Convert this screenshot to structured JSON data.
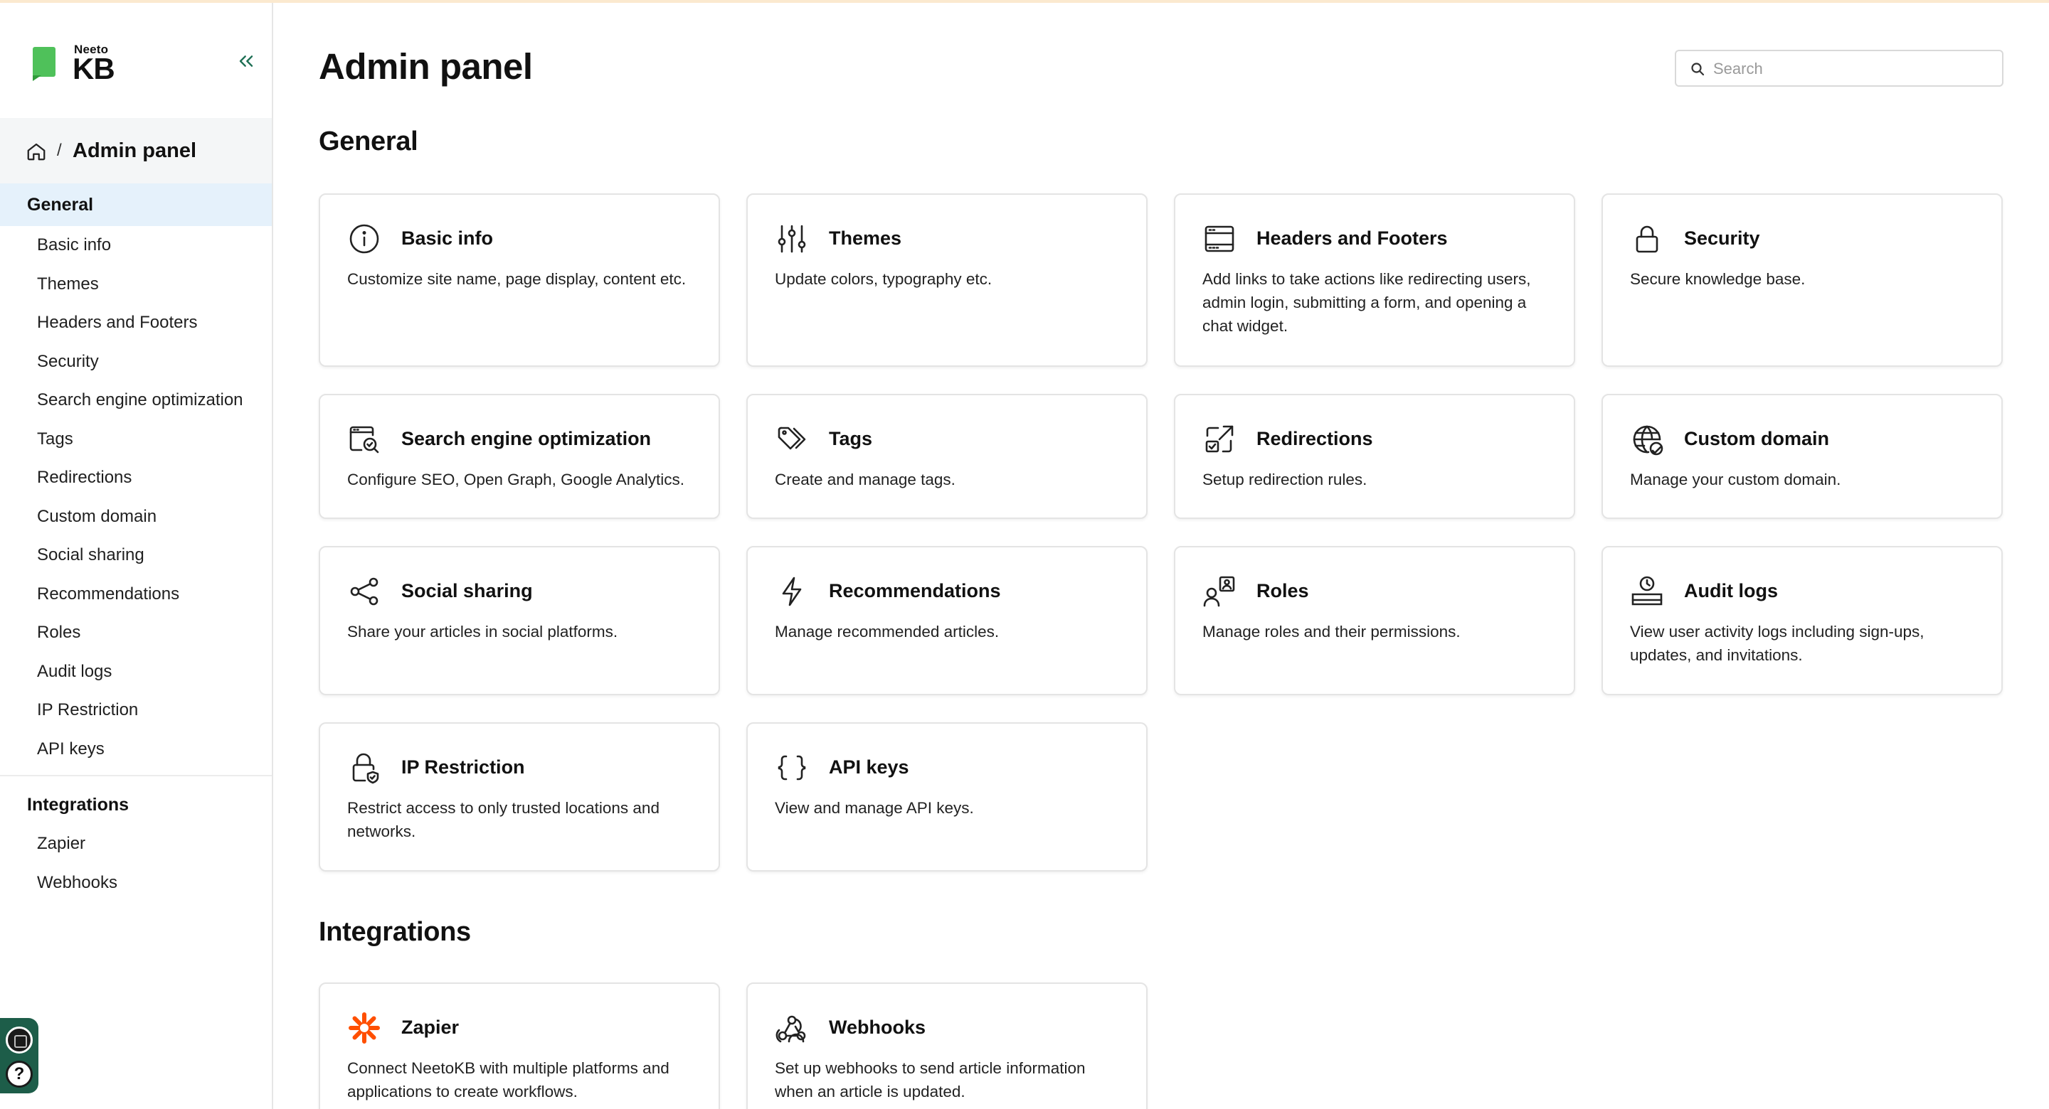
{
  "app": {
    "logo_small": "Neeto",
    "logo_big": "KB"
  },
  "breadcrumb": {
    "label": "Admin panel",
    "separator": "/"
  },
  "page": {
    "title": "Admin panel"
  },
  "search": {
    "placeholder": "Search"
  },
  "sidebar": {
    "general_label": "General",
    "general_items": [
      {
        "label": "Basic info"
      },
      {
        "label": "Themes"
      },
      {
        "label": "Headers and Footers"
      },
      {
        "label": "Security"
      },
      {
        "label": "Search engine optimization"
      },
      {
        "label": "Tags"
      },
      {
        "label": "Redirections"
      },
      {
        "label": "Custom domain"
      },
      {
        "label": "Social sharing"
      },
      {
        "label": "Recommendations"
      },
      {
        "label": "Roles"
      },
      {
        "label": "Audit logs"
      },
      {
        "label": "IP Restriction"
      },
      {
        "label": "API keys"
      }
    ],
    "integrations_label": "Integrations",
    "integration_items": [
      {
        "label": "Zapier"
      },
      {
        "label": "Webhooks"
      }
    ]
  },
  "sections": {
    "general": {
      "title": "General"
    },
    "integrations": {
      "title": "Integrations"
    }
  },
  "cards": {
    "general": [
      {
        "icon": "info-icon",
        "title": "Basic info",
        "desc": "Customize site name, page display, content etc."
      },
      {
        "icon": "sliders-icon",
        "title": "Themes",
        "desc": "Update colors, typography etc."
      },
      {
        "icon": "layout-icon",
        "title": "Headers and Footers",
        "desc": "Add links to take actions like redirecting users, admin login, submitting a form, and opening a chat widget."
      },
      {
        "icon": "lock-icon",
        "title": "Security",
        "desc": "Secure knowledge base."
      },
      {
        "icon": "seo-icon",
        "title": "Search engine optimization",
        "desc": "Configure SEO, Open Graph, Google Analytics."
      },
      {
        "icon": "tag-icon",
        "title": "Tags",
        "desc": "Create and manage tags."
      },
      {
        "icon": "redirect-icon",
        "title": "Redirections",
        "desc": "Setup redirection rules."
      },
      {
        "icon": "globe-icon",
        "title": "Custom domain",
        "desc": "Manage your custom domain."
      },
      {
        "icon": "share-icon",
        "title": "Social sharing",
        "desc": "Share your articles in social platforms."
      },
      {
        "icon": "lightning-icon",
        "title": "Recommendations",
        "desc": "Manage recommended articles."
      },
      {
        "icon": "roles-icon",
        "title": "Roles",
        "desc": "Manage roles and their permissions."
      },
      {
        "icon": "audit-icon",
        "title": "Audit logs",
        "desc": "View user activity logs including sign-ups, updates, and invitations."
      },
      {
        "icon": "lock-shield-icon",
        "title": "IP Restriction",
        "desc": "Restrict access to only trusted locations and networks."
      },
      {
        "icon": "braces-icon",
        "title": "API keys",
        "desc": "View and manage API keys."
      }
    ],
    "integrations": [
      {
        "icon": "zapier-icon",
        "title": "Zapier",
        "desc": "Connect NeetoKB with multiple platforms and applications to create workflows."
      },
      {
        "icon": "webhook-icon",
        "title": "Webhooks",
        "desc": "Set up webhooks to send article information when an article is updated."
      }
    ]
  },
  "colors": {
    "accent_active_bg": "#e5f1fb",
    "brand_green": "#4fc15a",
    "collapse_green": "#1d6f54",
    "zapier_orange": "#ff4f00"
  }
}
